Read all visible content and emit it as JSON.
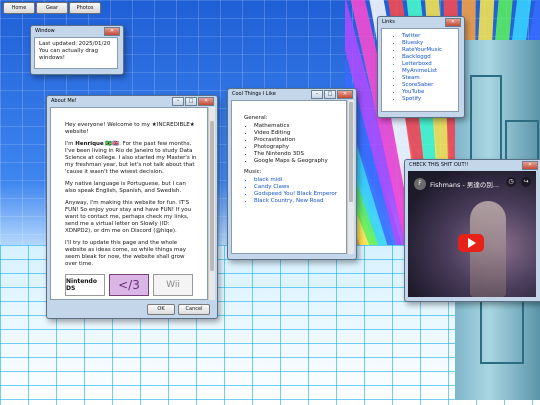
{
  "topbar": {
    "buttons": [
      "Home",
      "Gear",
      "Photos"
    ]
  },
  "window_small": {
    "title": "Window",
    "updated": "Last updated: 2025/01/20",
    "text": "You can actually drag windows!"
  },
  "about": {
    "title": "About Me!",
    "p1": "Hey everyone! Welcome to my ★INCREDIBLE★ website!",
    "p2_pre": "I'm ",
    "p2_name": "Henrique",
    "p2_post": " 🇧🇷🇬🇧. For the past few months, I've been living in Rio de Janeiro to study Data Science at college. I also started my Master's in my freshman year, but let's not talk about that 'cause it wasn't the wisest decision.",
    "p3": "My native language is Portuguese, but I can also speak English, Spanish, and Swedish.",
    "p4": "Anyway, I'm making this website for fun. IT'S FUN! So enjoy your stay and have FUN! If you want to contact me, perhaps check my links, send me a virtual letter on Slowly (ID: XDNPD2), or dm me on Discord (@hiqe).",
    "p5": "I'll try to update this page and the whole website as ideas come, so while things may seem bleak for now, the website shall grow over time.",
    "badges": [
      "Nintendo DS",
      "</3",
      "Wii"
    ],
    "ok": "OK",
    "cancel": "Cancel"
  },
  "cool": {
    "title": "Cool Things I Like",
    "general_label": "General:",
    "general": [
      "Mathematics",
      "Video Editing",
      "Procrastination",
      "Photography",
      "The Nintendo 3DS",
      "Google Maps & Geography"
    ],
    "music_label": "Music:",
    "music": [
      "black midi",
      "Candy Claws",
      "Godspeed You! Black Emperor",
      "Black Country, New Road"
    ]
  },
  "links": {
    "title": "Links",
    "items": [
      "Twitter",
      "Bluesky",
      "RateYourMusic",
      "Backloggd",
      "Letterboxd",
      "MyAnimeList",
      "Steam",
      "ScoreSaber",
      "YouTube",
      "Spotify"
    ]
  },
  "video": {
    "title": "CHECK THIS SHIT OUT!!",
    "video_title": "Fishmans - 男達の別...",
    "channel": "F",
    "watch_later": "Watch later",
    "share": "Share"
  },
  "colors": {
    "link": "#1155cc",
    "youtube_red": "#e62117",
    "rainbow": [
      "#ff4a4a",
      "#ffa23a",
      "#ffe84a",
      "#5cf25c",
      "#3ad6ff",
      "#3a6bff",
      "#b24aff",
      "#ff4ad1",
      "#ffffff",
      "#ff4a4a",
      "#4affc8",
      "#ffe84a"
    ]
  }
}
